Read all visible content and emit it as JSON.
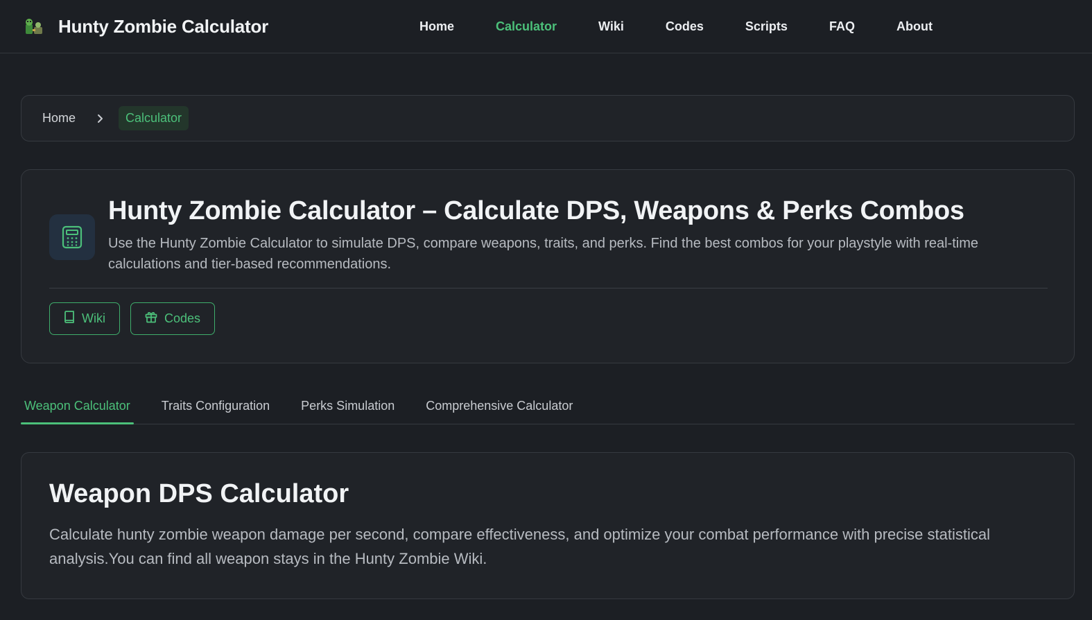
{
  "brand": {
    "title": "Hunty Zombie Calculator",
    "logo_icon": "zombie-logo-icon"
  },
  "nav": {
    "items": [
      {
        "label": "Home",
        "active": false
      },
      {
        "label": "Calculator",
        "active": true
      },
      {
        "label": "Wiki",
        "active": false
      },
      {
        "label": "Codes",
        "active": false
      },
      {
        "label": "Scripts",
        "active": false
      },
      {
        "label": "FAQ",
        "active": false
      },
      {
        "label": "About",
        "active": false
      }
    ]
  },
  "breadcrumb": {
    "home": "Home",
    "current": "Calculator",
    "separator_icon": "chevron-right-icon"
  },
  "hero": {
    "icon": "calculator-icon",
    "title": "Hunty Zombie Calculator – Calculate DPS, Weapons & Perks Combos",
    "description": "Use the Hunty Zombie Calculator to simulate DPS, compare weapons, traits, and perks. Find the best combos for your playstyle with real-time calculations and tier-based recommendations.",
    "buttons": [
      {
        "label": "Wiki",
        "icon": "book-icon"
      },
      {
        "label": "Codes",
        "icon": "gift-icon"
      }
    ]
  },
  "tabs": [
    {
      "label": "Weapon Calculator",
      "active": true
    },
    {
      "label": "Traits Configuration",
      "active": false
    },
    {
      "label": "Perks Simulation",
      "active": false
    },
    {
      "label": "Comprehensive Calculator",
      "active": false
    }
  ],
  "panel": {
    "title": "Weapon DPS Calculator",
    "description": "Calculate hunty zombie weapon damage per second, compare effectiveness, and optimize your combat performance with precise statistical analysis.You can find all weapon stays in the Hunty Zombie Wiki."
  },
  "colors": {
    "accent": "#4cc07a",
    "background": "#1c1f24",
    "card": "#202328",
    "border": "#363a40"
  }
}
